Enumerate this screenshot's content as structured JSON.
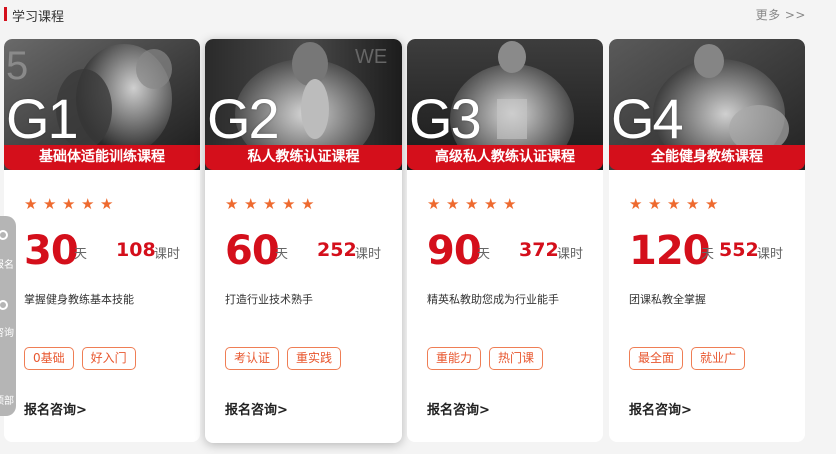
{
  "header": {
    "title": "学习课程",
    "more": "更多 >>"
  },
  "cards": [
    {
      "code": "G1",
      "name": "基础体适能训练课程",
      "days": "30",
      "days_unit": "天",
      "hours": "108",
      "hours_unit": "课时",
      "desc": "掌握健身教练基本技能",
      "tags": [
        "0基础",
        "好入门"
      ],
      "cta": "报名咨询>"
    },
    {
      "code": "G2",
      "name": "私人教练认证课程",
      "days": "60",
      "days_unit": "天",
      "hours": "252",
      "hours_unit": "课时",
      "desc": "打造行业技术熟手",
      "tags": [
        "考认证",
        "重实践"
      ],
      "cta": "报名咨询>"
    },
    {
      "code": "G3",
      "name": "高级私人教练认证课程",
      "days": "90",
      "days_unit": "天",
      "hours": "372",
      "hours_unit": "课时",
      "desc": "精英私教助您成为行业能手",
      "tags": [
        "重能力",
        "热门课"
      ],
      "cta": "报名咨询>"
    },
    {
      "code": "G4",
      "name": "全能健身教练课程",
      "days": "120",
      "days_unit": "天",
      "hours": "552",
      "hours_unit": "课时",
      "desc": "团课私教全掌握",
      "tags": [
        "最全面",
        "就业广"
      ],
      "cta": "报名咨询>"
    }
  ],
  "rating_stars": 5,
  "side_widget": {
    "items": [
      "报名",
      "咨询",
      "顶部"
    ]
  },
  "colors": {
    "brand_red": "#d40f1b",
    "tag_orange": "#e8572f",
    "star": "#ee6a2f"
  }
}
